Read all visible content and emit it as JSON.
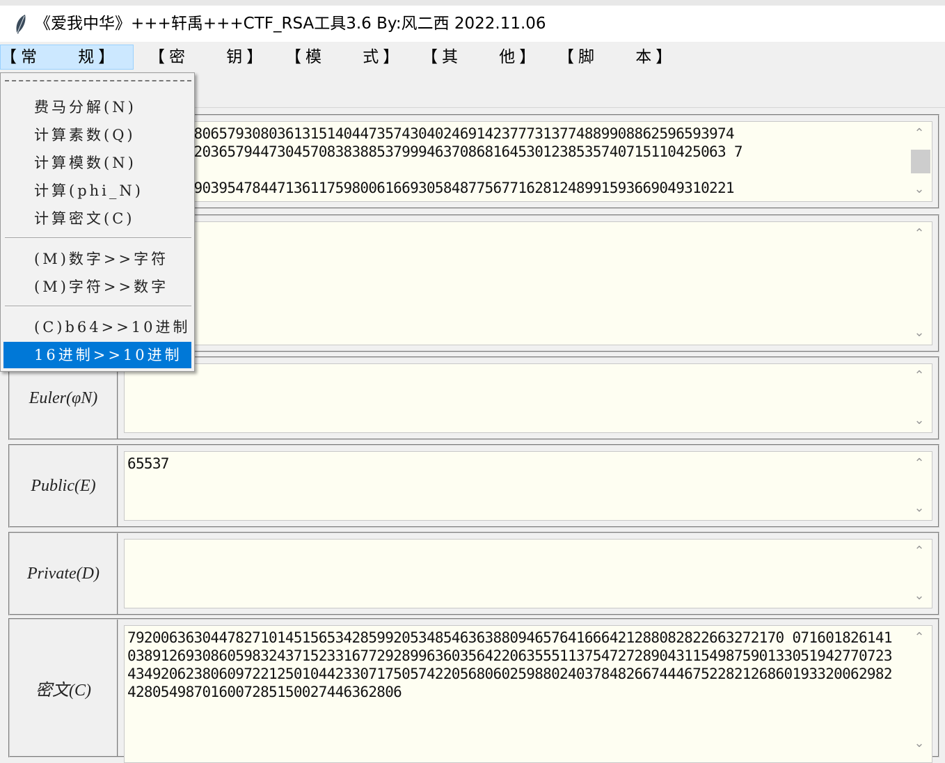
{
  "window": {
    "title": "《爱我中华》+++轩禹+++CTF_RSA工具3.6   By:风二西 2022.11.06"
  },
  "menubar": {
    "items": [
      {
        "label": "【常    规】"
      },
      {
        "label": "【密    钥】"
      },
      {
        "label": "【模    式】"
      },
      {
        "label": "【其    他】"
      },
      {
        "label": "【脚    本】"
      }
    ]
  },
  "dropdown": {
    "group1": [
      "费马分解(N)",
      "计算素数(Q)",
      "计算模数(N)",
      "计算(phi_N)",
      "计算密文(C)"
    ],
    "group2": [
      "(M)数字>>字符",
      "(M)字符>>数字"
    ],
    "group3": [
      "(C)b64>>10进制",
      "16进制>>10进制"
    ],
    "selected": "16进制>>10进制"
  },
  "fields": {
    "n_value": "0940699980657930803613151404473574304024691423777313774889908862596593974\n634793472036579447304570838388537999463708681645301238535740715110425063 7\n\n1204622990395478447136117598006166930584877567716281248991593669049310221",
    "p_value": "",
    "euler_label": "Euler(φN)",
    "euler_value": "",
    "public_label": "Public(E)",
    "public_value": "65537",
    "private_label": "Private(D)",
    "private_value": "",
    "cipher_label": "密文(C)",
    "cipher_value": "7920063630447827101451565342859920534854636388094657641666421288082822663272170 0716018261410389126930860598324371523316772928996360356422063555113754727289043115498759013305194277072343492062380609722125010442330717505742205680602598802403784826674446752282126860193320062982428054987016007285150027446362806"
  },
  "colors": {
    "field_bg": "#fefef2",
    "menu_highlight": "#0078d7",
    "menu_active": "#cce8ff"
  }
}
